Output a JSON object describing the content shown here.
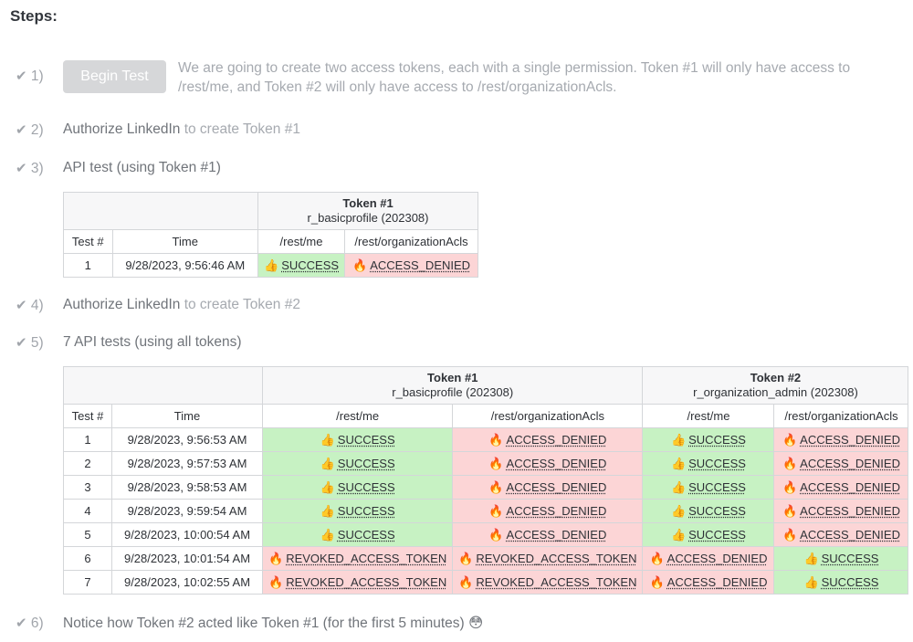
{
  "heading": "Steps:",
  "check": "✔",
  "steps": [
    {
      "num": "1)"
    },
    {
      "num": "2)",
      "strong": "Authorize LinkedIn",
      "rest": " to create Token #1"
    },
    {
      "num": "3)",
      "strong": "API test (using Token #1)"
    },
    {
      "num": "4)",
      "strong": "Authorize LinkedIn",
      "rest": " to create Token #2"
    },
    {
      "num": "5)",
      "strong": "7 API tests (using all tokens)"
    },
    {
      "num": "6)",
      "strong": "Notice how Token #2 acted like Token #1 (for the first 5 minutes) 😳"
    }
  ],
  "begin_button": "Begin Test",
  "intro_text": "We are going to create two access tokens, each with a single permission. Token #1 will only have access to /rest/me, and Token #2 will only have access to /rest/organizationAcls.",
  "colors": {
    "success_bg": "#c7f2c3",
    "denied_bg": "#fcd5d6"
  },
  "icons": {
    "success": "👍",
    "denied": "🔥"
  },
  "table1": {
    "token1_title": "Token #1",
    "token1_scope": "r_basicprofile (202308)",
    "headers": [
      "Test #",
      "Time",
      "/rest/me",
      "/rest/organizationAcls"
    ],
    "rows": [
      {
        "n": "1",
        "time": "9/28/2023, 9:56:46 AM",
        "me": "SUCCESS",
        "acls": "ACCESS_DENIED"
      }
    ]
  },
  "table2": {
    "token1_title": "Token #1",
    "token1_scope": "r_basicprofile (202308)",
    "token2_title": "Token #2",
    "token2_scope": "r_organization_admin (202308)",
    "headers": [
      "Test #",
      "Time",
      "/rest/me",
      "/rest/organizationAcls",
      "/rest/me",
      "/rest/organizationAcls"
    ],
    "rows": [
      {
        "n": "1",
        "time": "9/28/2023, 9:56:53 AM",
        "c": [
          "SUCCESS",
          "ACCESS_DENIED",
          "SUCCESS",
          "ACCESS_DENIED"
        ]
      },
      {
        "n": "2",
        "time": "9/28/2023, 9:57:53 AM",
        "c": [
          "SUCCESS",
          "ACCESS_DENIED",
          "SUCCESS",
          "ACCESS_DENIED"
        ]
      },
      {
        "n": "3",
        "time": "9/28/2023, 9:58:53 AM",
        "c": [
          "SUCCESS",
          "ACCESS_DENIED",
          "SUCCESS",
          "ACCESS_DENIED"
        ]
      },
      {
        "n": "4",
        "time": "9/28/2023, 9:59:54 AM",
        "c": [
          "SUCCESS",
          "ACCESS_DENIED",
          "SUCCESS",
          "ACCESS_DENIED"
        ]
      },
      {
        "n": "5",
        "time": "9/28/2023, 10:00:54 AM",
        "c": [
          "SUCCESS",
          "ACCESS_DENIED",
          "SUCCESS",
          "ACCESS_DENIED"
        ]
      },
      {
        "n": "6",
        "time": "9/28/2023, 10:01:54 AM",
        "c": [
          "REVOKED_ACCESS_TOKEN",
          "REVOKED_ACCESS_TOKEN",
          "ACCESS_DENIED",
          "SUCCESS"
        ]
      },
      {
        "n": "7",
        "time": "9/28/2023, 10:02:55 AM",
        "c": [
          "REVOKED_ACCESS_TOKEN",
          "REVOKED_ACCESS_TOKEN",
          "ACCESS_DENIED",
          "SUCCESS"
        ]
      }
    ]
  }
}
